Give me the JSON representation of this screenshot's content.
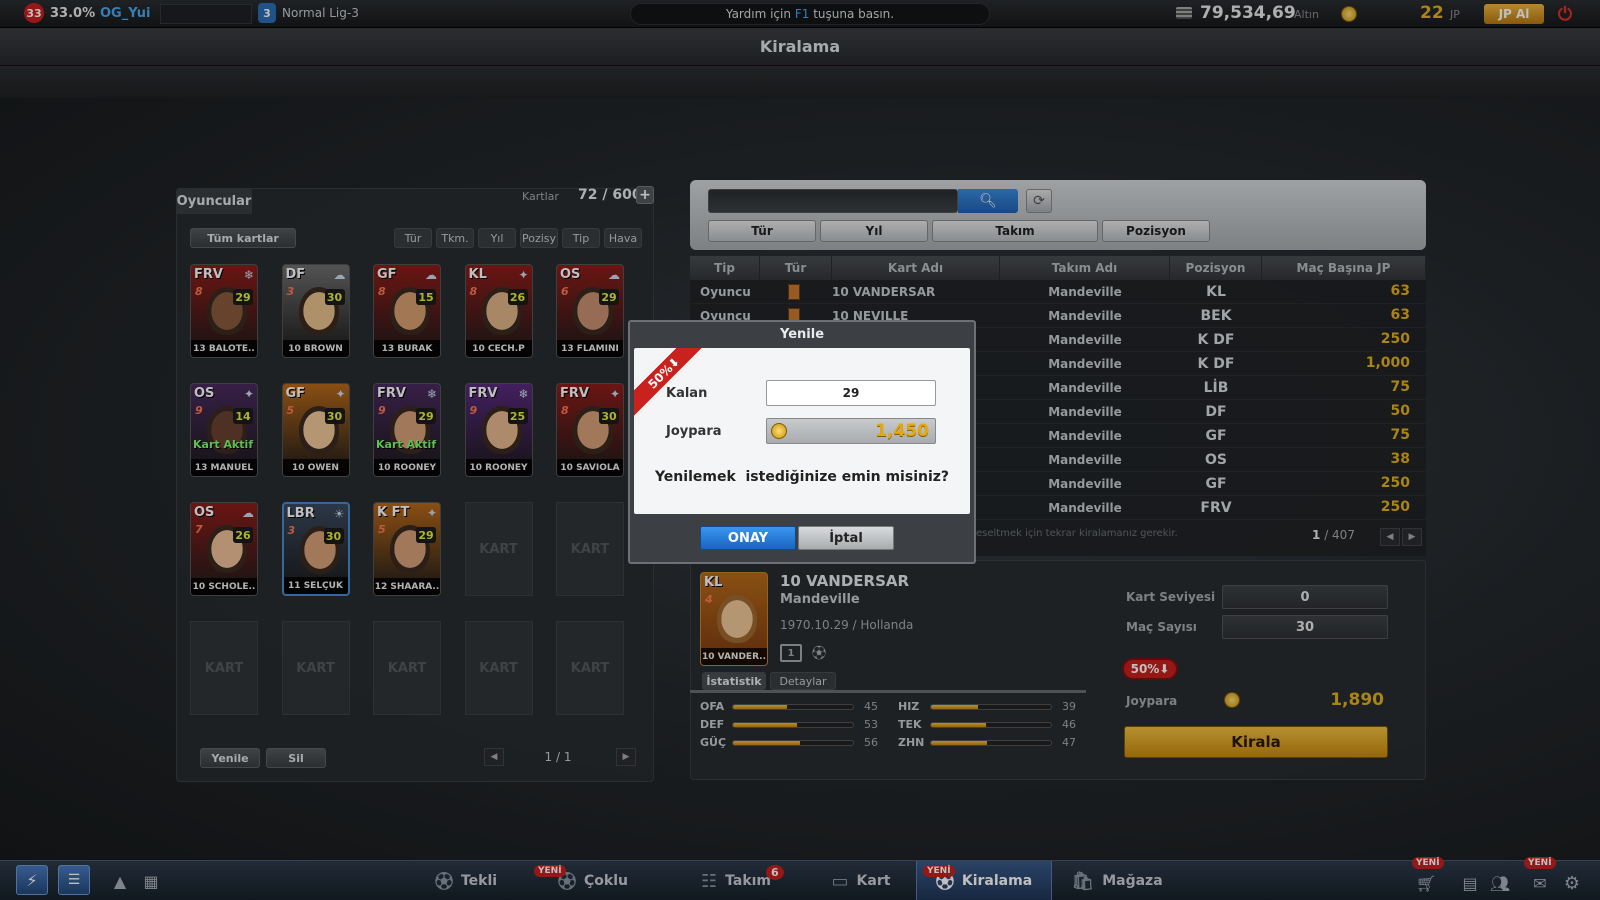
{
  "topbar": {
    "level": "33",
    "percent": "33.0%",
    "username": "OG_Yui",
    "league_badge": "3",
    "league": "Normal Lig-3",
    "help_prefix": "Yardım için",
    "help_key": "F1",
    "help_suffix": "tuşuna basın.",
    "gold": "79,534,69",
    "gold_label": "Altın",
    "jp": "22",
    "jp_label": "JP",
    "jp_buy": "JP Al",
    "icons": [
      "coin-stack-icon",
      "joypara-coin-icon",
      "power-icon"
    ]
  },
  "title": "Kiralama",
  "left_panel": {
    "title": "Oyuncular",
    "cards_label": "Kartlar",
    "cards_count": "72 / 600",
    "all_cards": "Tüm kartlar",
    "filters": [
      "Tür",
      "Tkm.",
      "Yıl",
      "Pozisy",
      "Tip",
      "Hava"
    ],
    "cards": [
      {
        "pos": "FRV",
        "lv": "8",
        "ovr": "29",
        "name": "13 BALOTE..",
        "color": "#8e1d1a",
        "skin": "#8a5a3c",
        "wx": "❄",
        "active": ""
      },
      {
        "pos": "DF",
        "lv": "3",
        "ovr": "30",
        "name": "10 BROWN",
        "color": "#6f6f6f",
        "skin": "#e8c08c",
        "wx": "☁",
        "active": ""
      },
      {
        "pos": "GF",
        "lv": "8",
        "ovr": "15",
        "name": "13 BURAK",
        "color": "#8e1d1a",
        "skin": "#d8a070",
        "wx": "☁",
        "active": ""
      },
      {
        "pos": "KL",
        "lv": "8",
        "ovr": "26",
        "name": "10 CECH.P",
        "color": "#8e1d1a",
        "skin": "#e0b48a",
        "wx": "✦",
        "active": ""
      },
      {
        "pos": "OS",
        "lv": "6",
        "ovr": "29",
        "name": "13 FLAMINI",
        "color": "#8e1d1a",
        "skin": "#c89070",
        "wx": "☁",
        "active": ""
      },
      {
        "pos": "OS",
        "lv": "9",
        "ovr": "14",
        "name": "13 MANUEL",
        "color": "#4a2a5e",
        "skin": "#6a4030",
        "wx": "✦",
        "active": "Kart Aktif"
      },
      {
        "pos": "GF",
        "lv": "5",
        "ovr": "30",
        "name": "10 OWEN",
        "color": "#b8691a",
        "skin": "#f0c89a",
        "wx": "✦",
        "active": ""
      },
      {
        "pos": "FRV",
        "lv": "9",
        "ovr": "29",
        "name": "10 ROONEY",
        "color": "#4a2a5e",
        "skin": "#d8a078",
        "wx": "❄",
        "active": "Kart Aktif"
      },
      {
        "pos": "FRV",
        "lv": "9",
        "ovr": "25",
        "name": "10 ROONEY",
        "color": "#5a2a7e",
        "skin": "#e8b890",
        "wx": "❄",
        "active": ""
      },
      {
        "pos": "FRV",
        "lv": "8",
        "ovr": "30",
        "name": "10 SAVIOLA",
        "color": "#8e1d1a",
        "skin": "#d8a078",
        "wx": "✦",
        "active": ""
      },
      {
        "pos": "OS",
        "lv": "7",
        "ovr": "26",
        "name": "10 SCHOLE..",
        "color": "#8e1d1a",
        "skin": "#f0c09a",
        "wx": "☁",
        "active": ""
      },
      {
        "pos": "LBR",
        "lv": "3",
        "ovr": "30",
        "name": "11 SELÇUK",
        "color": "#3a4a5e",
        "skin": "#d8a078",
        "wx": "☀",
        "active": ""
      },
      {
        "pos": "K FT",
        "lv": "5",
        "ovr": "29",
        "name": "12 SHAARA..",
        "color": "#b8691a",
        "skin": "#d8a078",
        "wx": "✦",
        "active": ""
      }
    ],
    "empty_label": "KART",
    "renew": "Yenile",
    "delete": "Sil",
    "page": "1 / 1"
  },
  "search": {
    "placeholder": "",
    "filters": [
      "Tür",
      "Yıl",
      "Takım",
      "Pozisyon"
    ]
  },
  "table": {
    "headers": [
      "Tip",
      "Tür",
      "Kart Adı",
      "Takım Adı",
      "Pozisyon",
      "Maç Başına JP"
    ],
    "rows": [
      {
        "tip": "Oyuncu",
        "name": "10 VANDERSAR",
        "team": "Mandeville",
        "pos": "KL",
        "jp": "63"
      },
      {
        "tip": "Oyuncu",
        "name": "10 NEVILLE",
        "team": "Mandeville",
        "pos": "BEK",
        "jp": "63"
      },
      {
        "tip": "",
        "name": "",
        "team": "Mandeville",
        "pos": "K DF",
        "jp": "250"
      },
      {
        "tip": "",
        "name": "",
        "team": "Mandeville",
        "pos": "K DF",
        "jp": "1,000"
      },
      {
        "tip": "",
        "name": "",
        "team": "Mandeville",
        "pos": "LİB",
        "jp": "75"
      },
      {
        "tip": "",
        "name": "",
        "team": "Mandeville",
        "pos": "DF",
        "jp": "50"
      },
      {
        "tip": "",
        "name": "",
        "team": "Mandeville",
        "pos": "GF",
        "jp": "75"
      },
      {
        "tip": "",
        "name": "",
        "team": "Mandeville",
        "pos": "OS",
        "jp": "38"
      },
      {
        "tip": "",
        "name": "",
        "team": "Mandeville",
        "pos": "GF",
        "jp": "250"
      },
      {
        "tip": "",
        "name": "",
        "team": "Mandeville",
        "pos": "FRV",
        "jp": "250"
      }
    ],
    "footnote": "eseltmek için tekrar kiralamanız gerekir.",
    "page_current": "1",
    "page_total": "/ 407"
  },
  "detail": {
    "card_pos": "KL",
    "card_lv": "4",
    "card_name": "10 VANDER..",
    "name": "10 VANDERSAR",
    "team": "Mandeville",
    "birth": "1970.10.29 / Hollanda",
    "tab_stats": "İstatistik",
    "tab_details": "Detaylar",
    "stats": [
      {
        "label": "OFA",
        "value": "45",
        "fill": 0.45
      },
      {
        "label": "HIZ",
        "value": "39",
        "fill": 0.39
      },
      {
        "label": "DEF",
        "value": "53",
        "fill": 0.53
      },
      {
        "label": "TEK",
        "value": "46",
        "fill": 0.46
      },
      {
        "label": "GÜÇ",
        "value": "56",
        "fill": 0.56
      },
      {
        "label": "ZHN",
        "value": "47",
        "fill": 0.47
      }
    ],
    "card_level_label": "Kart Seviyesi",
    "card_level": "0",
    "match_count_label": "Maç Sayısı",
    "match_count": "30",
    "discount": "50%",
    "joypara_label": "Joypara",
    "joypara": "1,890",
    "rent": "Kirala"
  },
  "dialog": {
    "title": "Yenile",
    "ribbon": "50%",
    "remaining_label": "Kalan",
    "remaining": "29",
    "joypara_label": "Joypara",
    "joypara": "1,450",
    "question": "Yenilemek  istediğinize emin misiniz?",
    "confirm": "ONAY",
    "cancel": "İptal"
  },
  "bottombar": {
    "badge_yeni": "YENİ",
    "nav": [
      {
        "label": "Tekli",
        "icon": "single-player-icon",
        "badge": ""
      },
      {
        "label": "Çoklu",
        "icon": "multi-player-icon",
        "badge": "YENİ"
      },
      {
        "label": "Takım",
        "icon": "team-icon",
        "badge": "6"
      },
      {
        "label": "Kart",
        "icon": "card-icon",
        "badge": ""
      },
      {
        "label": "Kiralama",
        "icon": "rental-icon",
        "badge": "YENİ"
      },
      {
        "label": "Mağaza",
        "icon": "shop-icon",
        "badge": ""
      }
    ]
  },
  "colors": {
    "accent": "#e4b020",
    "confirm": "#1f7bd6",
    "danger": "#c9211e"
  }
}
